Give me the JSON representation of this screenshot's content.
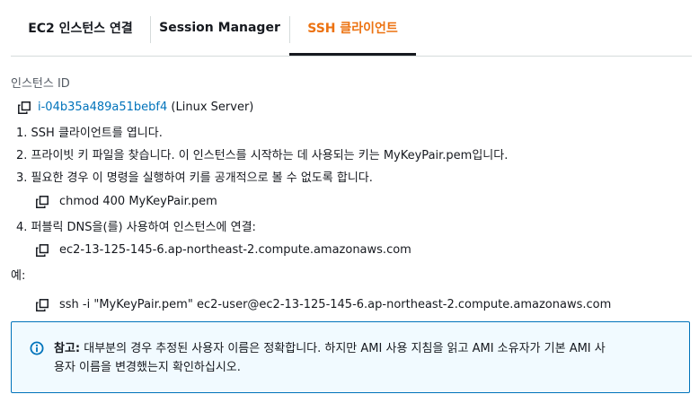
{
  "tabs": [
    {
      "label": "EC2 인스턴스 연결"
    },
    {
      "label": "Session Manager"
    },
    {
      "label": "SSH 클라이언트"
    }
  ],
  "active_tab": "SSH 클라이언트",
  "instance": {
    "label": "인스턴스 ID",
    "id": "i-04b35a489a51bebf4",
    "name": "(Linux Server)"
  },
  "steps": [
    {
      "text": "1. SSH 클라이언트를 엽니다."
    },
    {
      "text": "2. 프라이빗 키 파일을 찾습니다. 이 인스턴스를 시작하는 데 사용되는 키는 MyKeyPair.pem입니다."
    },
    {
      "text": "3. 필요한 경우 이 명령을 실행하여 키를 공개적으로 볼 수 없도록 합니다.",
      "command": "chmod 400 MyKeyPair.pem"
    },
    {
      "text": "4. 퍼블릭 DNS을(를) 사용하여 인스턴스에 연결:",
      "command": "ec2-13-125-145-6.ap-northeast-2.compute.amazonaws.com"
    }
  ],
  "example": {
    "label": "예:",
    "command": "ssh -i \"MyKeyPair.pem\" ec2-user@ec2-13-125-145-6.ap-northeast-2.compute.amazonaws.com"
  },
  "note": {
    "title": "참고:",
    "line1": "대부분의 경우 추정된 사용자 이름은 정확합니다. 하지만 AMI 사용 지침을 읽고 AMI 소유자가 기본 AMI 사",
    "line2": "용자 이름을 변경했는지 확인하십시오."
  },
  "colors": {
    "accent": "#ec7211",
    "link": "#0073bb",
    "info_bg": "#f1faff",
    "info_border": "#0073bb"
  },
  "icons": [
    "copy-icon",
    "info-icon"
  ]
}
